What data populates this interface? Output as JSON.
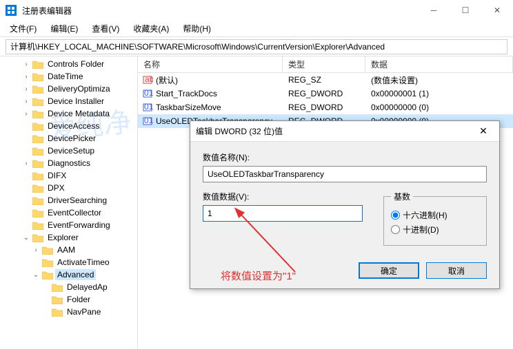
{
  "window": {
    "title": "注册表编辑器"
  },
  "menu": {
    "file": "文件(F)",
    "edit": "编辑(E)",
    "view": "查看(V)",
    "favorites": "收藏夹(A)",
    "help": "帮助(H)"
  },
  "address": {
    "value": "计算机\\HKEY_LOCAL_MACHINE\\SOFTWARE\\Microsoft\\Windows\\CurrentVersion\\Explorer\\Advanced"
  },
  "tree": [
    {
      "d": 2,
      "e": ">",
      "l": "Controls Folder"
    },
    {
      "d": 2,
      "e": ">",
      "l": "DateTime"
    },
    {
      "d": 2,
      "e": ">",
      "l": "DeliveryOptimiza"
    },
    {
      "d": 2,
      "e": ">",
      "l": "Device Installer"
    },
    {
      "d": 2,
      "e": ">",
      "l": "Device Metadata"
    },
    {
      "d": 2,
      "e": "",
      "l": "DeviceAccess"
    },
    {
      "d": 2,
      "e": "",
      "l": "DevicePicker"
    },
    {
      "d": 2,
      "e": "",
      "l": "DeviceSetup"
    },
    {
      "d": 2,
      "e": ">",
      "l": "Diagnostics"
    },
    {
      "d": 2,
      "e": "",
      "l": "DIFX"
    },
    {
      "d": 2,
      "e": "",
      "l": "DPX"
    },
    {
      "d": 2,
      "e": "",
      "l": "DriverSearching"
    },
    {
      "d": 2,
      "e": "",
      "l": "EventCollector"
    },
    {
      "d": 2,
      "e": "",
      "l": "EventForwarding"
    },
    {
      "d": 2,
      "e": "v",
      "l": "Explorer"
    },
    {
      "d": 3,
      "e": ">",
      "l": "AAM"
    },
    {
      "d": 3,
      "e": "",
      "l": "ActivateTimeo"
    },
    {
      "d": 3,
      "e": "v",
      "l": "Advanced",
      "sel": true
    },
    {
      "d": 4,
      "e": "",
      "l": "DelayedAp"
    },
    {
      "d": 4,
      "e": "",
      "l": "Folder"
    },
    {
      "d": 4,
      "e": "",
      "l": "NavPane"
    }
  ],
  "list": {
    "headers": {
      "name": "名称",
      "type": "类型",
      "data": "数据"
    },
    "rows": [
      {
        "icon": "str",
        "name": "(默认)",
        "type": "REG_SZ",
        "data": "(数值未设置)"
      },
      {
        "icon": "bin",
        "name": "Start_TrackDocs",
        "type": "REG_DWORD",
        "data": "0x00000001 (1)"
      },
      {
        "icon": "bin",
        "name": "TaskbarSizeMove",
        "type": "REG_DWORD",
        "data": "0x00000000 (0)"
      },
      {
        "icon": "bin",
        "name": "UseOLEDTaskbarTransparency",
        "type": "REG_DWORD",
        "data": "0x00000000 (0)",
        "sel": true
      }
    ]
  },
  "dialog": {
    "title": "编辑 DWORD (32 位)值",
    "name_label": "数值名称(N):",
    "name_value": "UseOLEDTaskbarTransparency",
    "data_label": "数值数据(V):",
    "data_value": "1",
    "base_label": "基数",
    "radix_hex": "十六进制(H)",
    "radix_dec": "十进制(D)",
    "ok": "确定",
    "cancel": "取消"
  },
  "annotation": {
    "text": "将数值设置为\"1\""
  },
  "watermark": "爱纯净"
}
